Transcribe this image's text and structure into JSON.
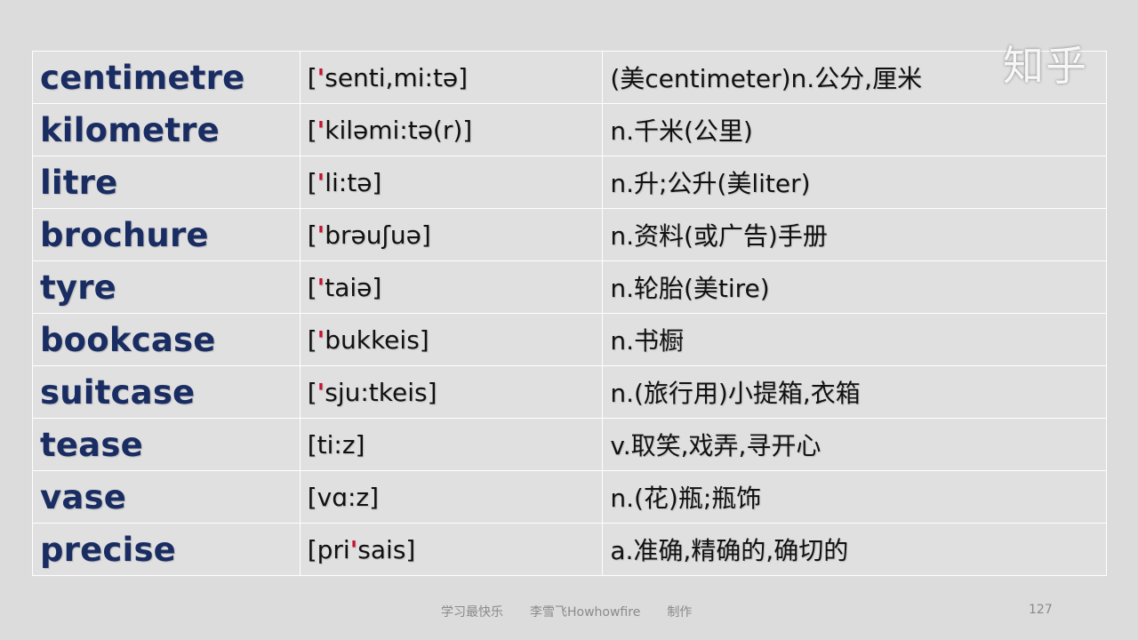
{
  "watermark": "知乎",
  "rows": [
    {
      "word": "centimetre",
      "phon_pre": "[",
      "phon_stress": "'",
      "phon_post": "senti,mi:tə]",
      "meaning": "(美centimeter)n.公分,厘米"
    },
    {
      "word": "kilometre",
      "phon_pre": "[",
      "phon_stress": "'",
      "phon_post": "kiləmi:tə(r)]",
      "meaning": "n.千米(公里)"
    },
    {
      "word": "litre",
      "phon_pre": "[",
      "phon_stress": "'",
      "phon_post": "li:tə]",
      "meaning": "n.升;公升(美liter)"
    },
    {
      "word": "brochure",
      "phon_pre": "[",
      "phon_stress": "'",
      "phon_post": "brəuʃuə]",
      "meaning": "n.资料(或广告)手册"
    },
    {
      "word": "tyre",
      "phon_pre": "[",
      "phon_stress": "'",
      "phon_post": "taiə]",
      "meaning": "n.轮胎(美tire)"
    },
    {
      "word": "bookcase",
      "phon_pre": "[",
      "phon_stress": "'",
      "phon_post": "bukkeis]",
      "meaning": "n.书橱"
    },
    {
      "word": "suitcase",
      "phon_pre": "[",
      "phon_stress": "'",
      "phon_post": "sju:tkeis]",
      "meaning": "n.(旅行用)小提箱,衣箱"
    },
    {
      "word": "tease",
      "phon_pre": "[ti:z]",
      "phon_stress": "",
      "phon_post": "",
      "meaning": "v.取笑,戏弄,寻开心"
    },
    {
      "word": "vase",
      "phon_pre": "[vɑ:z]",
      "phon_stress": "",
      "phon_post": "",
      "meaning": "n.(花)瓶;瓶饰"
    },
    {
      "word": "precise",
      "phon_pre": "[pri",
      "phon_stress": "'",
      "phon_post": "sais]",
      "meaning": "a.准确,精确的,确切的"
    }
  ],
  "footer": {
    "left": "学习最快乐",
    "center": "李雪飞Howhowfire",
    "right": "制作",
    "page_number": "127"
  },
  "colors": {
    "background": "#dcdcdc",
    "word": "#1a2d63",
    "stress_mark": "#c8102e",
    "grid_line": "#ffffff"
  }
}
